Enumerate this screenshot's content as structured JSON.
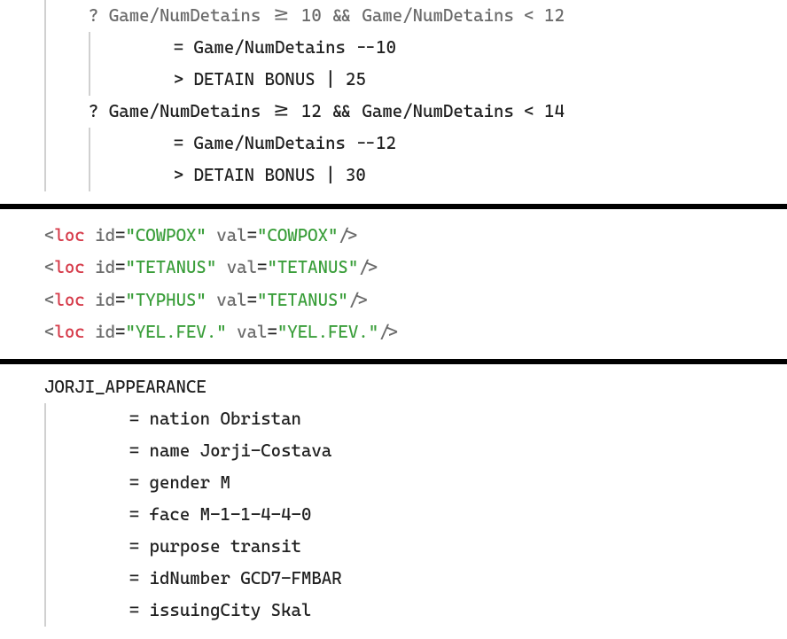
{
  "block1": {
    "cond1": "? Game/NumDetains >= 10 && Game/NumDetains < 12",
    "assign1": "    = Game/NumDetains --10",
    "out1": "    > DETAIN BONUS | 25",
    "cond2": "? Game/NumDetains >= 12 && Game/NumDetains < 14",
    "assign2": "    = Game/NumDetains --12",
    "out2": "    > DETAIN BONUS | 30"
  },
  "xml": {
    "rows": [
      {
        "id": "COWPOX",
        "val": "COWPOX"
      },
      {
        "id": "TETANUS",
        "val": "TETANUS"
      },
      {
        "id": "TYPHUS",
        "val": "TETANUS"
      },
      {
        "id": "YEL.FEV.",
        "val": "YEL.FEV."
      }
    ],
    "r0_id": "\"COWPOX\"",
    "r0_val": "\"COWPOX\"",
    "r1_id": "\"TETANUS\"",
    "r1_val": "\"TETANUS\"",
    "r2_id": "\"TYPHUS\"",
    "r2_val": "\"TETANUS\"",
    "r3_id": "\"YEL.FEV.\"",
    "r3_val": "\"YEL.FEV.\"",
    "tag": "loc",
    "lt": "<",
    "gt": "/>",
    "sp": " ",
    "id_attr": "id",
    "val_attr": "val",
    "eq": "="
  },
  "block3": {
    "header": "JORJI_APPEARANCE",
    "l1": "    = nation Obristan",
    "l2": "    = name Jorji-Costava",
    "l3": "    = gender M",
    "l4": "    = face M-1-1-4-4-0",
    "l5": "    = purpose transit",
    "l6": "    = idNumber GCD7-FMBAR",
    "l7": "    = issuingCity Skal"
  }
}
